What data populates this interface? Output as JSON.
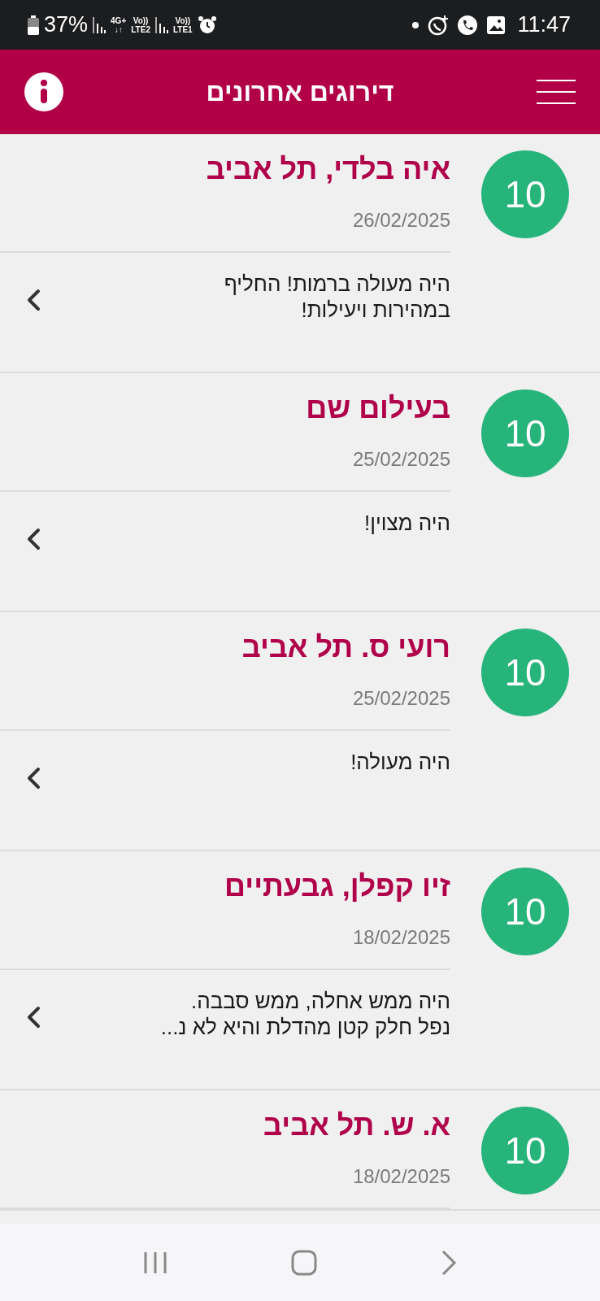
{
  "status_bar": {
    "battery": "37%",
    "network_1": {
      "top": "4G+",
      "bottom": "↓↑"
    },
    "volte_2": {
      "top": "Vo))",
      "bottom": "LTE2"
    },
    "volte_1": {
      "top": "Vo))",
      "bottom": "LTE1"
    },
    "time": "11:47"
  },
  "header": {
    "title": "דירוגים אחרונים"
  },
  "reviews": [
    {
      "score": "10",
      "name": "איה בלדי, תל אביב",
      "date": "26/02/2025",
      "comment_lines": [
        "היה מעולה ברמות! החליף",
        "במהירות ויעילות!"
      ]
    },
    {
      "score": "10",
      "name": "בעילום שם",
      "date": "25/02/2025",
      "comment_lines": [
        "היה מצוין!"
      ]
    },
    {
      "score": "10",
      "name": "רועי ס. תל אביב",
      "date": "25/02/2025",
      "comment_lines": [
        "היה מעולה!"
      ]
    },
    {
      "score": "10",
      "name": "זיו קפלן, גבעתיים",
      "date": "18/02/2025",
      "comment_lines": [
        "היה ממש אחלה, ממש סבבה.",
        "נפל חלק קטן מהדלת והיא לא נ..."
      ]
    },
    {
      "score": "10",
      "name": "א. ש. תל אביב",
      "date": "18/02/2025"
    }
  ]
}
